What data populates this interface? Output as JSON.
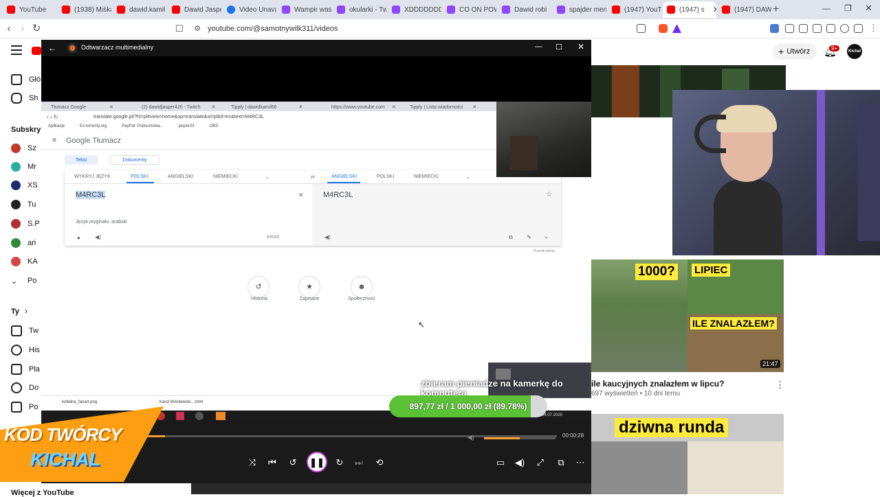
{
  "browser": {
    "tabs": [
      {
        "label": "YouTube",
        "color": "#ff0000"
      },
      {
        "label": "(1938) Miśka",
        "color": "#ff0000"
      },
      {
        "label": "dawid.kamil",
        "color": "#ff0000"
      },
      {
        "label": "Dawid Jasper",
        "color": "#ff0000"
      },
      {
        "label": "Video Unava",
        "color": "#1a73e8"
      },
      {
        "label": "Wampir was",
        "color": "#9146ff"
      },
      {
        "label": "okularki - Tw",
        "color": "#9146ff"
      },
      {
        "label": "XDDDDDDD",
        "color": "#9146ff"
      },
      {
        "label": "CO ON POW",
        "color": "#9146ff"
      },
      {
        "label": "Dawid robi",
        "color": "#9146ff"
      },
      {
        "label": "spajder men",
        "color": "#9146ff"
      },
      {
        "label": "(1947) YouT",
        "color": "#ff0000"
      },
      {
        "label": "(1947) s",
        "color": "#ff0000",
        "active": true
      },
      {
        "label": "(1947) DAWI",
        "color": "#ff0000"
      }
    ],
    "new_tab": "+",
    "url": "youtube.com/@samotnywilk311/videos"
  },
  "youtube": {
    "create_label": "Utwórz",
    "notif_badge": "9+",
    "avatar_text": "Kichal",
    "sidebar": {
      "home": "Głó",
      "shorts": "Sh",
      "subs_header": "Subskryp",
      "subs": [
        "Sz",
        "Mr",
        "XS",
        "Tu",
        "S.P",
        "ari",
        "KA",
        "Po"
      ],
      "you_header": "Ty",
      "you_items": [
        "Tw",
        "His",
        "Pla",
        "Do",
        "Po"
      ],
      "more": "Więcej z YouTube"
    },
    "videos": [
      {
        "title": "ile kaucyjnych znalazłem w lipcu?",
        "meta": "697 wyświetleń • 10 dni temu",
        "duration": "21:47",
        "thumb_text_1": "1000?",
        "thumb_text_2": "LIPIEC",
        "thumb_text_3": "ILE ZNALAZŁEM?"
      },
      {
        "thumb_text_1": "dziwna runda"
      }
    ],
    "stream_overlay": {
      "donate_title": "zbieram pieniadze na kamerkę do komputera",
      "progress_text": "897,77 zł / 1 000,00 zł (89.78%)",
      "progress_pct": 89.78,
      "creator_code_line1": "KOD TWÓRCY",
      "creator_code_line2": "KICHAL"
    }
  },
  "media_player": {
    "title": "Odtwarzacz multimedialny",
    "time": "00:00:28",
    "progress_fraction": 0.05,
    "volume_fraction": 0.5
  },
  "translate": {
    "browser_tabs": [
      "Tłumacz Google",
      "(2) dawidjasper420 - Twitch",
      "Tipply | dawidkamil66",
      "https://www.youtube.com",
      "Tipply | Lista wiadomości"
    ],
    "url": "translate.google.pl/?hl=pl#view=home&op=translate&sl=pl&tl=en&text=M4RC3L",
    "bookmarks": [
      "Aplikacje",
      "Ex-torrenty.org",
      "PayPal: Podsumowa...",
      "jasper23",
      "OBS"
    ],
    "logo": "Google Tłumacz",
    "mode_text": "Tekst",
    "mode_docs": "Dokumenty",
    "source_langs": [
      "WYKRYJ JĘZYK",
      "POLSKI",
      "ANGIELSKI",
      "NIEMIECKI"
    ],
    "target_langs": [
      "ANGIELSKI",
      "POLSKI",
      "NIEMIECKI"
    ],
    "input_text": "M4RC3L",
    "output_text": "M4RC3L",
    "detected": "Język oryginału: arabski",
    "char_count": "6/5000",
    "feedback": "Prześlij opinię",
    "bottom_actions": [
      "Historia",
      "Zapisane",
      "Społeczność"
    ],
    "downloads": [
      "kofelina_fanart.png",
      "Karol Wiśniewski....html"
    ],
    "clock": "04.07.2020"
  },
  "colors": {
    "yt_red": "#ff0000",
    "donate_green": "#5bc236",
    "creator_orange": "#ff9e10",
    "creator_blue": "#6fd3ff"
  }
}
